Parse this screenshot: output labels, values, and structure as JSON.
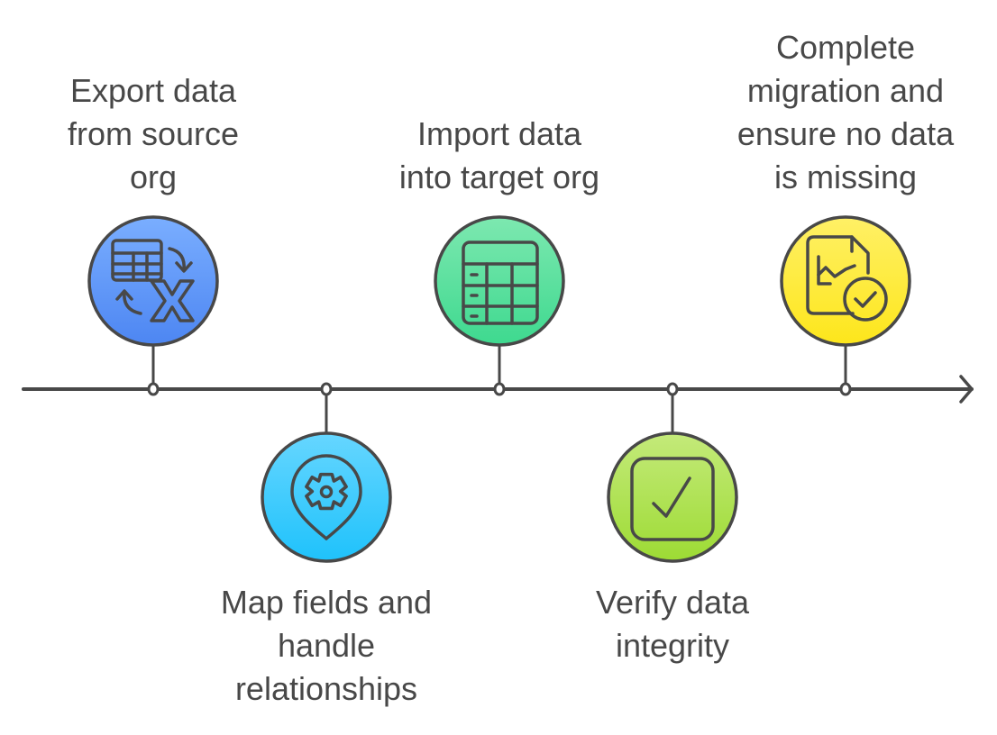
{
  "diagram": {
    "type": "timeline",
    "line_color": "#484848",
    "steps": [
      {
        "label": "Export data\nfrom source\norg",
        "icon": "spreadsheet-export-icon",
        "position": "above",
        "color_top": "#7aaeff",
        "color_bottom": "#4d86f2"
      },
      {
        "label": "Map fields and\nhandle\nrelationships",
        "icon": "location-gear-icon",
        "position": "below",
        "color_top": "#66d6ff",
        "color_bottom": "#1fc2fb"
      },
      {
        "label": "Import data\ninto target org",
        "icon": "table-icon",
        "position": "above",
        "color_top": "#7de8b0",
        "color_bottom": "#3ed98f"
      },
      {
        "label": "Verify data\nintegrity",
        "icon": "checkbox-icon",
        "position": "below",
        "color_top": "#c4ea7a",
        "color_bottom": "#9ddb34"
      },
      {
        "label": "Complete\nmigration and\nensure no data\nis missing",
        "icon": "report-check-icon",
        "position": "above",
        "color_top": "#fff066",
        "color_bottom": "#fde61b"
      }
    ]
  }
}
